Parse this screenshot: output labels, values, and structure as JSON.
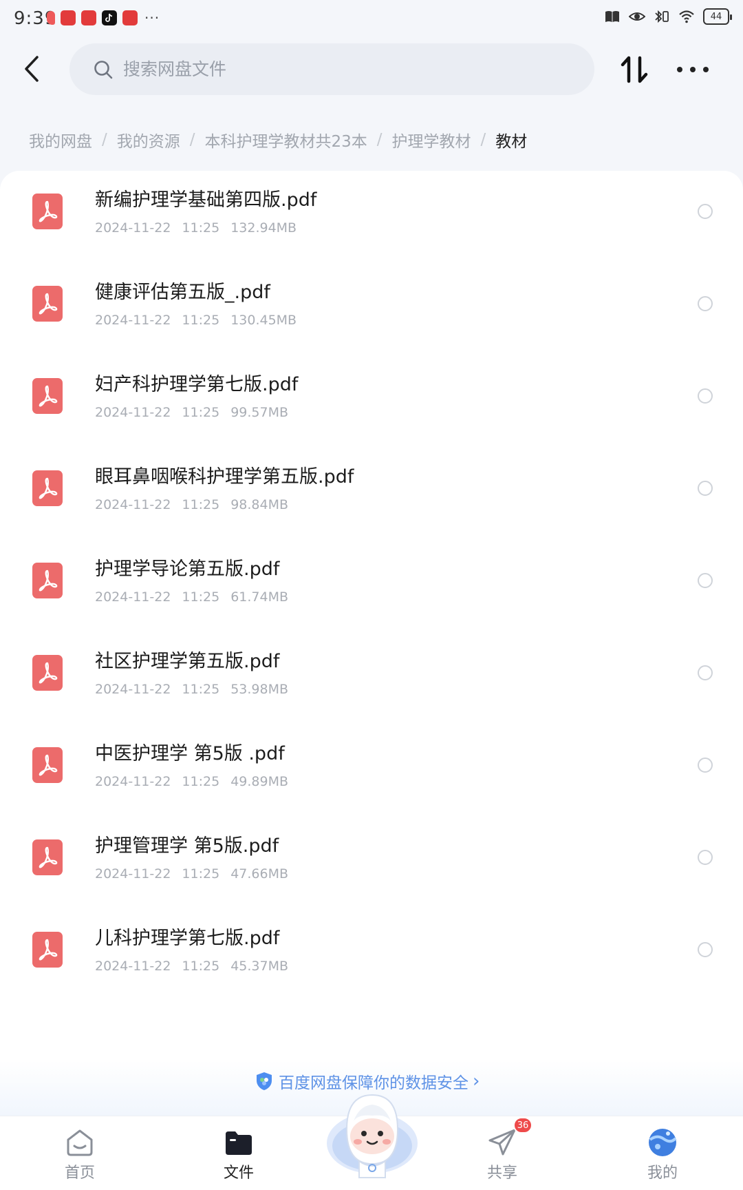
{
  "status_bar": {
    "time": "9:39",
    "battery": "44",
    "notification_icons": [
      "app-notification-icon",
      "huawei-app-icon",
      "xiaohongshu-icon",
      "douyin-icon",
      "huawei-app-icon"
    ],
    "more_indicator": "···"
  },
  "header": {
    "search_placeholder": "搜索网盘文件"
  },
  "breadcrumb": [
    {
      "label": "我的网盘"
    },
    {
      "label": "我的资源"
    },
    {
      "label": "本科护理学教材共23本"
    },
    {
      "label": "护理学教材"
    },
    {
      "label": "教材",
      "current": true
    }
  ],
  "breadcrumb_separator": "/",
  "files": [
    {
      "name": "新编护理学基础第四版.pdf",
      "date": "2024-11-22",
      "time": "11:25",
      "size": "132.94MB"
    },
    {
      "name": "健康评估第五版_.pdf",
      "date": "2024-11-22",
      "time": "11:25",
      "size": "130.45MB"
    },
    {
      "name": "妇产科护理学第七版.pdf",
      "date": "2024-11-22",
      "time": "11:25",
      "size": "99.57MB"
    },
    {
      "name": "眼耳鼻咽喉科护理学第五版.pdf",
      "date": "2024-11-22",
      "time": "11:25",
      "size": "98.84MB"
    },
    {
      "name": "护理学导论第五版.pdf",
      "date": "2024-11-22",
      "time": "11:25",
      "size": "61.74MB"
    },
    {
      "name": "社区护理学第五版.pdf",
      "date": "2024-11-22",
      "time": "11:25",
      "size": "53.98MB"
    },
    {
      "name": "中医护理学 第5版 .pdf",
      "date": "2024-11-22",
      "time": "11:25",
      "size": "49.89MB"
    },
    {
      "name": "护理管理学 第5版.pdf",
      "date": "2024-11-22",
      "time": "11:25",
      "size": "47.66MB"
    },
    {
      "name": "儿科护理学第七版.pdf",
      "date": "2024-11-22",
      "time": "11:25",
      "size": "45.37MB"
    }
  ],
  "safety_banner": {
    "text": "百度网盘保障你的数据安全",
    "arrow": "›"
  },
  "tabs": [
    {
      "label": "首页",
      "icon": "home-icon"
    },
    {
      "label": "文件",
      "icon": "folder-icon",
      "active": true
    },
    {
      "label": "共享",
      "icon": "paper-plane-icon",
      "badge": "36"
    },
    {
      "label": "我的",
      "icon": "profile-planet-icon"
    }
  ],
  "colors": {
    "accent": "#5e92e6",
    "pdf_icon": "#ec6b6b",
    "badge": "#ee4a4a",
    "background": "#f4f6fa"
  }
}
